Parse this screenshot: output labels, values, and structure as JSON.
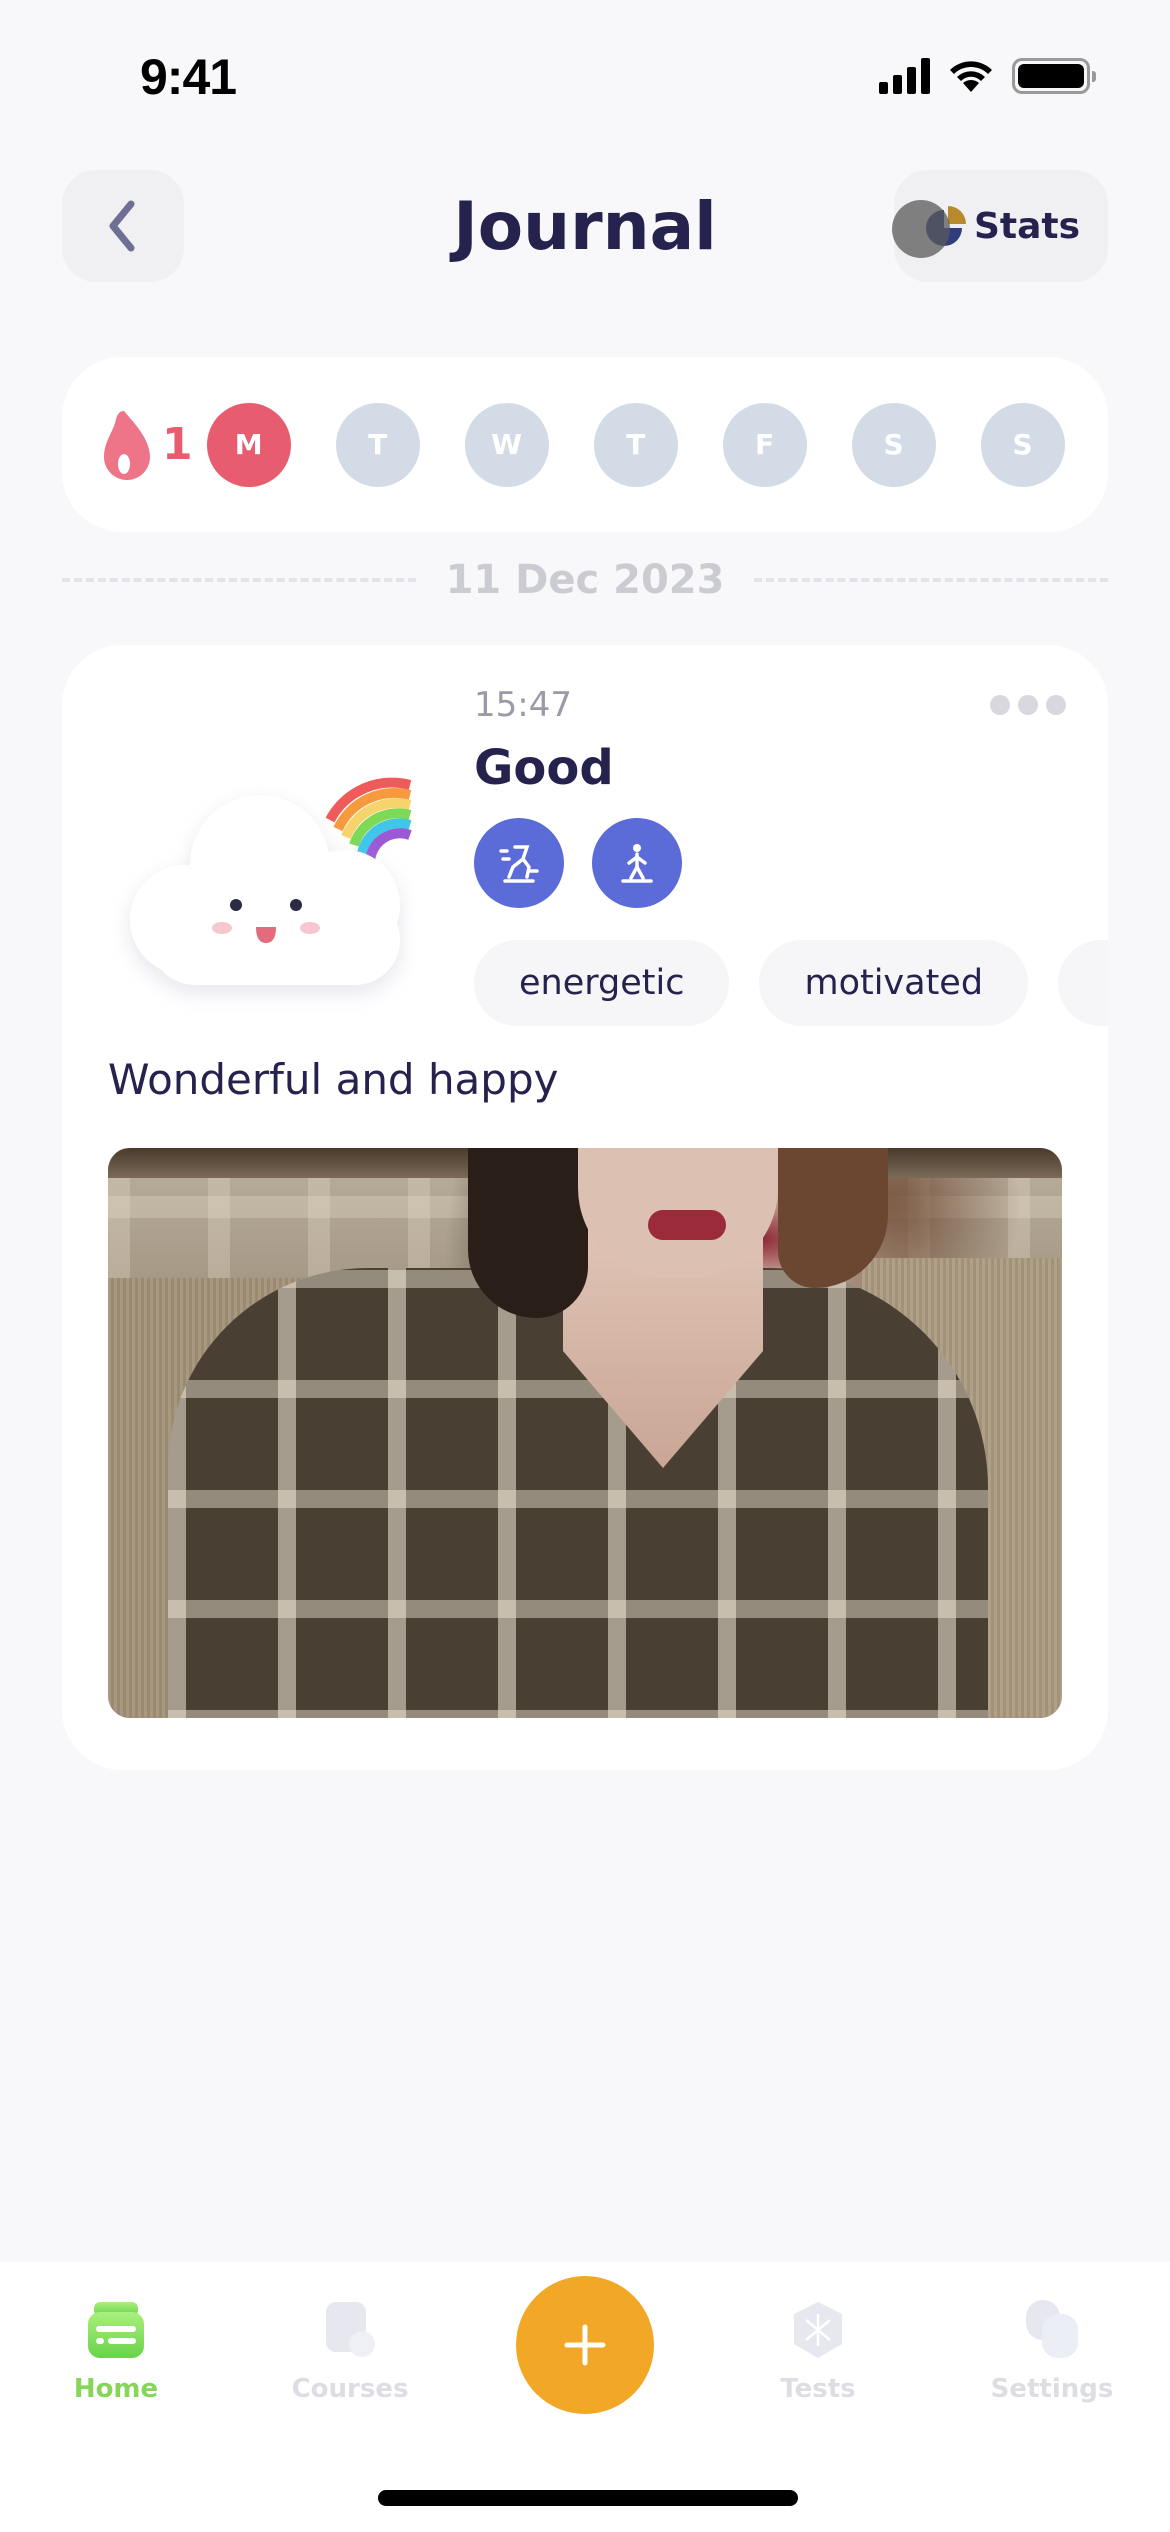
{
  "status_bar": {
    "time": "9:41"
  },
  "header": {
    "title": "Journal",
    "back_icon": "chevron-left-icon",
    "stats_label": "Stats",
    "stats_icon": "pie-chart-icon"
  },
  "week": {
    "streak_icon": "flame-icon",
    "streak_count": "1",
    "days": [
      {
        "label": "M",
        "active": true
      },
      {
        "label": "T",
        "active": false
      },
      {
        "label": "W",
        "active": false
      },
      {
        "label": "T",
        "active": false
      },
      {
        "label": "F",
        "active": false
      },
      {
        "label": "S",
        "active": false
      },
      {
        "label": "S",
        "active": false
      }
    ]
  },
  "date_label": "11 Dec 2023",
  "entry": {
    "time": "15:47",
    "mood": "Good",
    "mood_icon": "happy-cloud-rainbow-icon",
    "activities": [
      {
        "icon": "running-icon"
      },
      {
        "icon": "walking-icon"
      }
    ],
    "tags": [
      "energetic",
      "motivated",
      ""
    ],
    "note": "Wonderful and happy",
    "photo_alt": "Woman in plaid shirt sitting on couch"
  },
  "nav": {
    "items": [
      {
        "label": "Home",
        "icon": "home-icon",
        "active": true
      },
      {
        "label": "Courses",
        "icon": "courses-icon",
        "active": false
      },
      {
        "label": "Tests",
        "icon": "tests-icon",
        "active": false
      },
      {
        "label": "Settings",
        "icon": "settings-icon",
        "active": false
      }
    ],
    "add_icon": "plus-icon"
  },
  "colors": {
    "accent_red": "#e85c70",
    "activity_blue": "#5b6bd8",
    "add_orange": "#f3a726",
    "nav_active_green": "#86d759",
    "title_navy": "#25234d"
  }
}
